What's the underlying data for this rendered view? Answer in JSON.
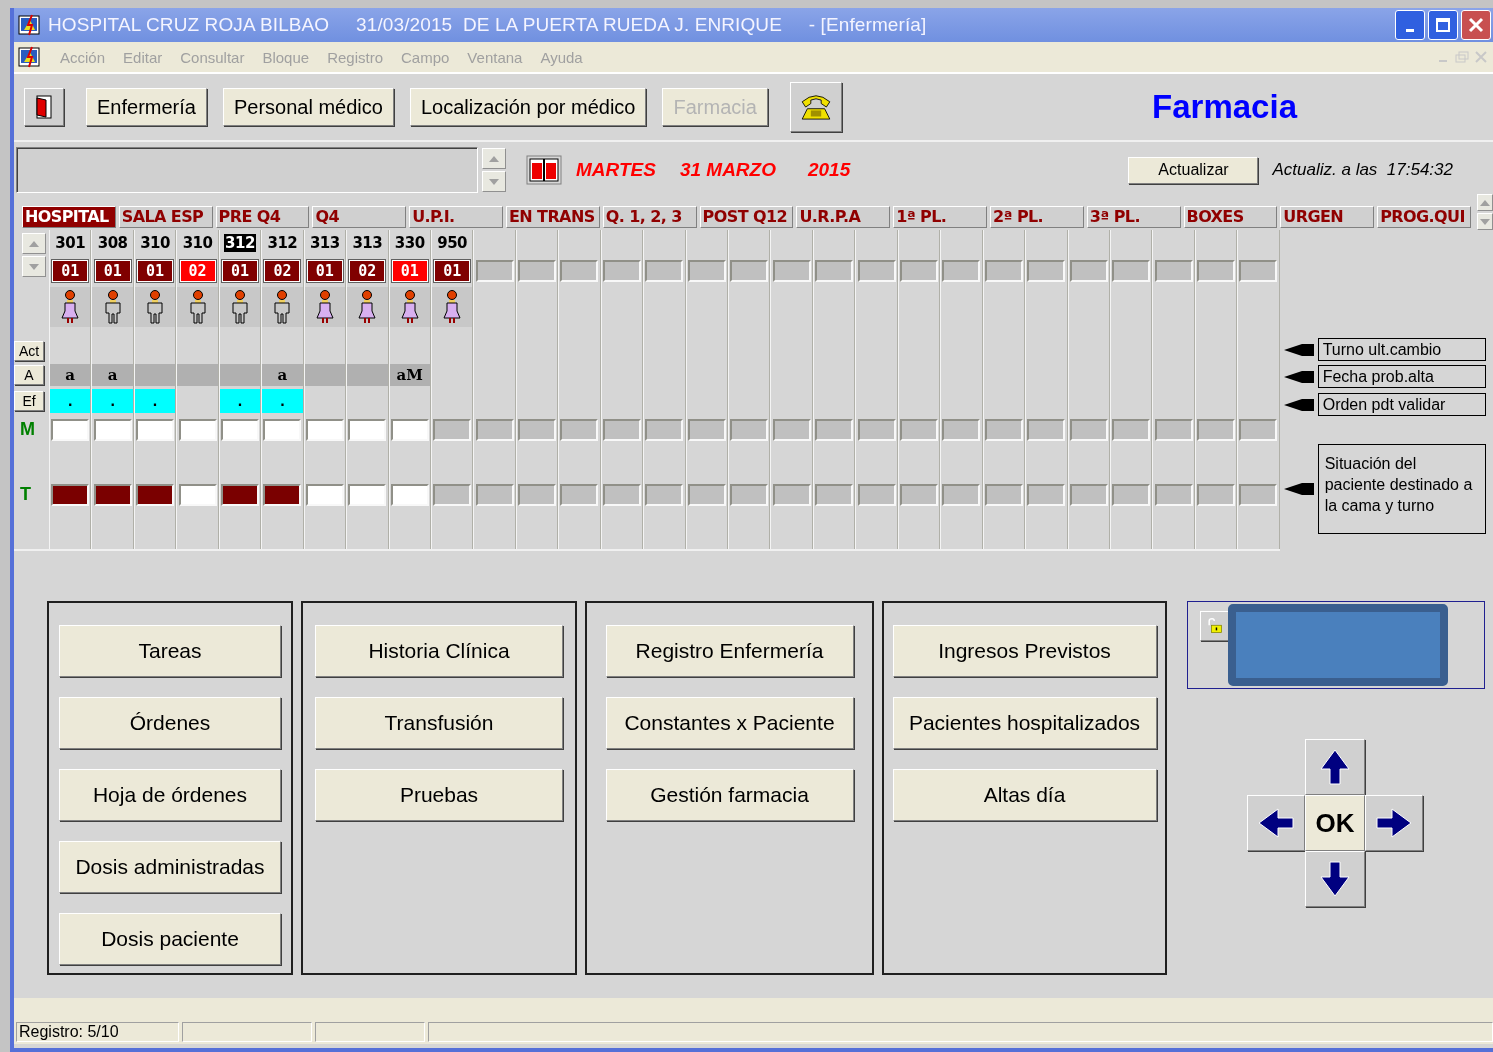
{
  "window": {
    "title": "HOSPITAL CRUZ ROJA BILBAO     31/03/2015  DE LA PUERTA RUEDA J. ENRIQUE     - [Enfermería]"
  },
  "menu": [
    "Acción",
    "Editar",
    "Consultar",
    "Bloque",
    "Registro",
    "Campo",
    "Ventana",
    "Ayuda"
  ],
  "toolbar": {
    "buttons": [
      {
        "label": "Enfermería",
        "disabled": false
      },
      {
        "label": "Personal médico",
        "disabled": false
      },
      {
        "label": "Localización por médico",
        "disabled": false
      },
      {
        "label": "Farmacia",
        "disabled": true
      }
    ],
    "section_title": "Farmacia"
  },
  "date_bar": {
    "day": "MARTES",
    "date": "31 MARZO",
    "year": "2015",
    "refresh_button": "Actualizar",
    "updated": "Actualiz. a las  17:54:32"
  },
  "tabs": [
    {
      "label": "HOSPITAL",
      "selected": true
    },
    {
      "label": "SALA ESP",
      "selected": false
    },
    {
      "label": "PRE Q4",
      "selected": false
    },
    {
      "label": "Q4",
      "selected": false
    },
    {
      "label": "U.P.I.",
      "selected": false
    },
    {
      "label": "EN TRANS",
      "selected": false
    },
    {
      "label": "Q. 1, 2, 3",
      "selected": false
    },
    {
      "label": "POST Q12",
      "selected": false
    },
    {
      "label": "U.R.P.A",
      "selected": false
    },
    {
      "label": "1ª PL.",
      "selected": false
    },
    {
      "label": "2ª PL.",
      "selected": false
    },
    {
      "label": "3ª PL.",
      "selected": false
    },
    {
      "label": "BOXES",
      "selected": false
    },
    {
      "label": "URGEN",
      "selected": false
    },
    {
      "label": "PROG.QUI",
      "selected": false
    }
  ],
  "row_buttons": [
    "Act",
    "A",
    "Ef"
  ],
  "shift_labels": [
    "M",
    "T"
  ],
  "beds": [
    {
      "kind": "bed",
      "number": "301",
      "selected": false,
      "code": "01",
      "alert": false,
      "female": true,
      "a_cell": true,
      "a_text": "a",
      "ef": true,
      "ef_text": ".",
      "m_available": true,
      "t_available": true,
      "t_occupied": true
    },
    {
      "kind": "bed",
      "number": "308",
      "selected": false,
      "code": "01",
      "alert": false,
      "female": false,
      "a_cell": true,
      "a_text": "a",
      "ef": true,
      "ef_text": ".",
      "m_available": true,
      "t_available": true,
      "t_occupied": true
    },
    {
      "kind": "bed",
      "number": "310",
      "selected": false,
      "code": "01",
      "alert": false,
      "female": false,
      "a_cell": true,
      "ef": true,
      "ef_text": ".",
      "m_available": true,
      "t_available": true,
      "t_occupied": true
    },
    {
      "kind": "bed",
      "number": "310",
      "selected": false,
      "code": "02",
      "alert": true,
      "female": false,
      "a_cell": true,
      "ef": false,
      "m_available": true,
      "t_available": true,
      "t_occupied": false
    },
    {
      "kind": "bed",
      "number": "312",
      "selected": true,
      "code": "01",
      "alert": false,
      "female": false,
      "a_cell": true,
      "ef": true,
      "ef_text": ".",
      "m_available": true,
      "t_available": true,
      "t_occupied": true
    },
    {
      "kind": "bed",
      "number": "312",
      "selected": false,
      "code": "02",
      "alert": false,
      "female": false,
      "a_cell": true,
      "a_text": "a",
      "ef": true,
      "ef_text": ".",
      "m_available": true,
      "t_available": true,
      "t_occupied": true
    },
    {
      "kind": "bed",
      "number": "313",
      "selected": false,
      "code": "01",
      "alert": false,
      "female": true,
      "a_cell": true,
      "ef": false,
      "m_available": true,
      "t_available": true,
      "t_occupied": false
    },
    {
      "kind": "bed",
      "number": "313",
      "selected": false,
      "code": "02",
      "alert": false,
      "female": true,
      "a_cell": true,
      "ef": false,
      "m_available": true,
      "t_available": true,
      "t_occupied": false
    },
    {
      "kind": "bed",
      "number": "330",
      "selected": false,
      "code": "01",
      "alert": true,
      "female": true,
      "a_cell": true,
      "a_text": "aM",
      "ef": false,
      "m_available": true,
      "t_available": true,
      "t_occupied": false
    },
    {
      "kind": "bed",
      "number": "950",
      "selected": false,
      "code": "01",
      "alert": false,
      "female": true,
      "a_cell": false,
      "ef": false,
      "m_available": false,
      "t_available": false,
      "t_occupied": false
    },
    {
      "kind": "empty"
    },
    {
      "kind": "empty"
    },
    {
      "kind": "empty"
    },
    {
      "kind": "empty"
    },
    {
      "kind": "empty"
    },
    {
      "kind": "empty"
    },
    {
      "kind": "empty"
    },
    {
      "kind": "empty"
    },
    {
      "kind": "empty"
    },
    {
      "kind": "empty"
    },
    {
      "kind": "empty"
    },
    {
      "kind": "empty"
    },
    {
      "kind": "empty"
    },
    {
      "kind": "empty"
    },
    {
      "kind": "empty"
    },
    {
      "kind": "empty"
    },
    {
      "kind": "empty"
    },
    {
      "kind": "empty"
    },
    {
      "kind": "empty"
    }
  ],
  "legend": [
    "Turno ult.cambio",
    "Fecha prob.alta",
    "Orden pdt validar",
    "Situación del paciente destinado a la cama y turno"
  ],
  "panels": [
    {
      "buttons": [
        "Tareas",
        "Órdenes",
        "Hoja de órdenes",
        "Dosis administradas",
        "Dosis paciente"
      ]
    },
    {
      "buttons": [
        "Historia Clínica",
        "Transfusión",
        "Pruebas"
      ]
    },
    {
      "buttons": [
        "Registro Enfermería",
        "Constantes x Paciente",
        "Gestión farmacia"
      ]
    },
    {
      "buttons": [
        "Ingresos Previstos",
        "Pacientes hospitalizados",
        "Altas día"
      ]
    }
  ],
  "navigation": {
    "ok": "OK"
  },
  "status_bar": {
    "record": "Registro: 5/10"
  }
}
